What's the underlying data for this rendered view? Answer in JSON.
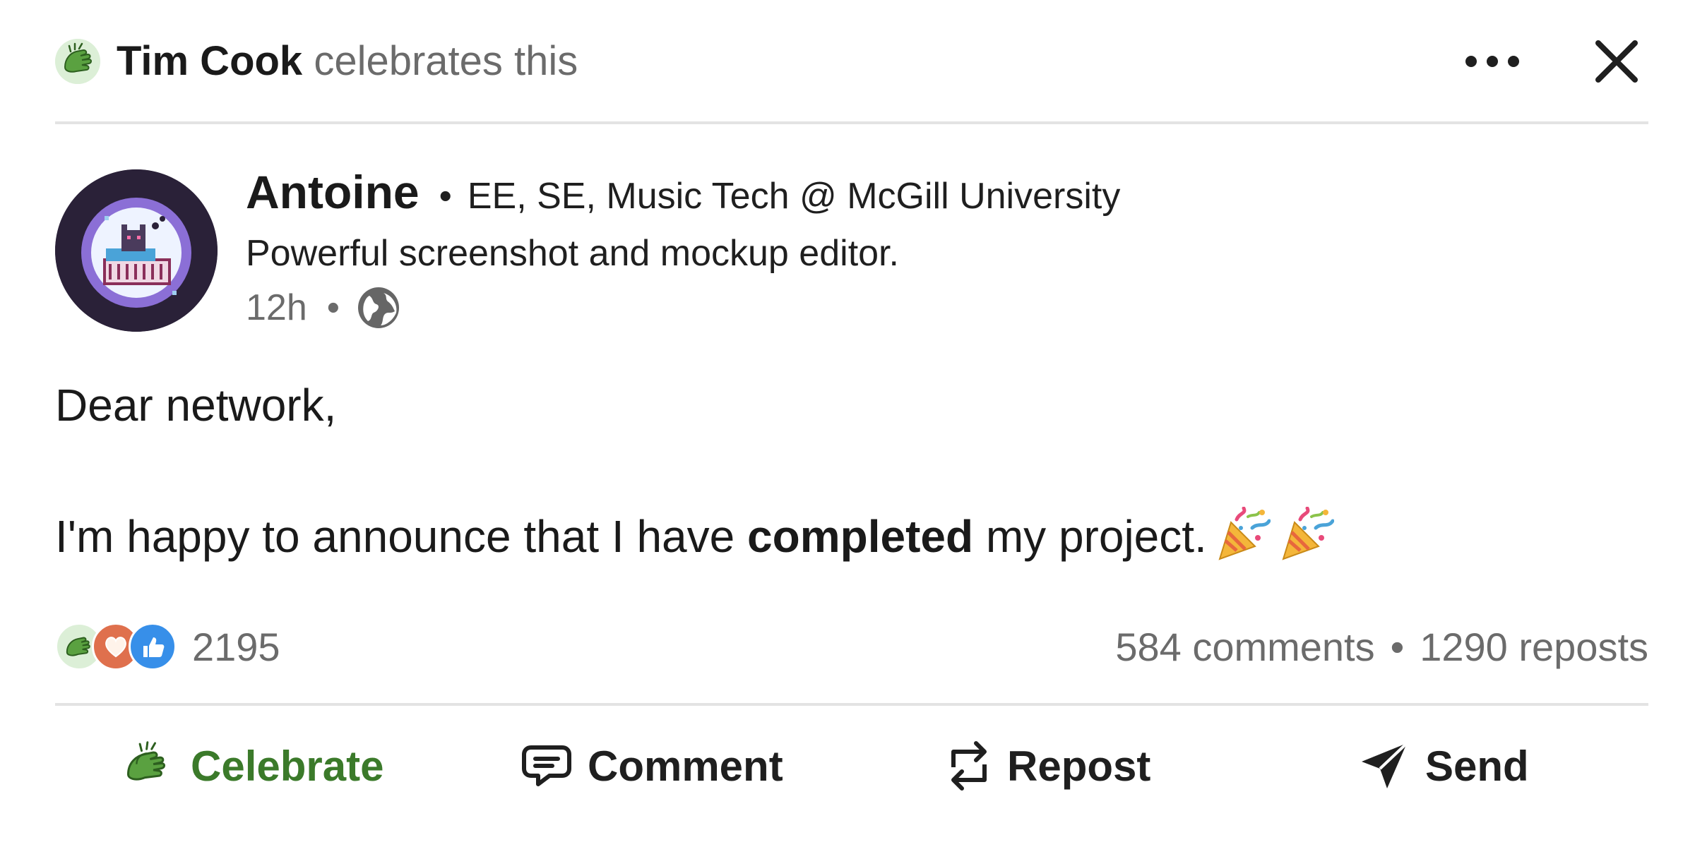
{
  "header": {
    "actor_name": "Tim Cook",
    "action_text": "celebrates this",
    "icons": {
      "reaction": "celebrate-icon",
      "more": "more-options-icon",
      "close": "close-icon"
    }
  },
  "author": {
    "name": "Antoine",
    "separator": "•",
    "subtitle": "EE, SE, Music Tech @ McGill University",
    "headline": "Powerful screenshot and mockup editor.",
    "time": "12h",
    "meta_separator": "•",
    "visibility_icon": "globe-icon"
  },
  "post": {
    "line1": "Dear network,",
    "line2_before": "I'm happy to announce that I have",
    "line2_bold": "completed",
    "line2_after": "my project.",
    "emoji_icon": "party-popper-icon"
  },
  "stats": {
    "reactions": [
      "celebrate-icon",
      "love-icon",
      "like-icon"
    ],
    "reaction_count": "2195",
    "comments": "584 comments",
    "separator": "•",
    "reposts": "1290 reposts"
  },
  "actions": {
    "celebrate": "Celebrate",
    "comment": "Comment",
    "repost": "Repost",
    "send": "Send"
  },
  "colors": {
    "accent_green": "#3b7a2a",
    "muted_text": "#6b6b6b",
    "divider": "#e3e3e3",
    "love": "#df704d",
    "like": "#378fe9"
  }
}
